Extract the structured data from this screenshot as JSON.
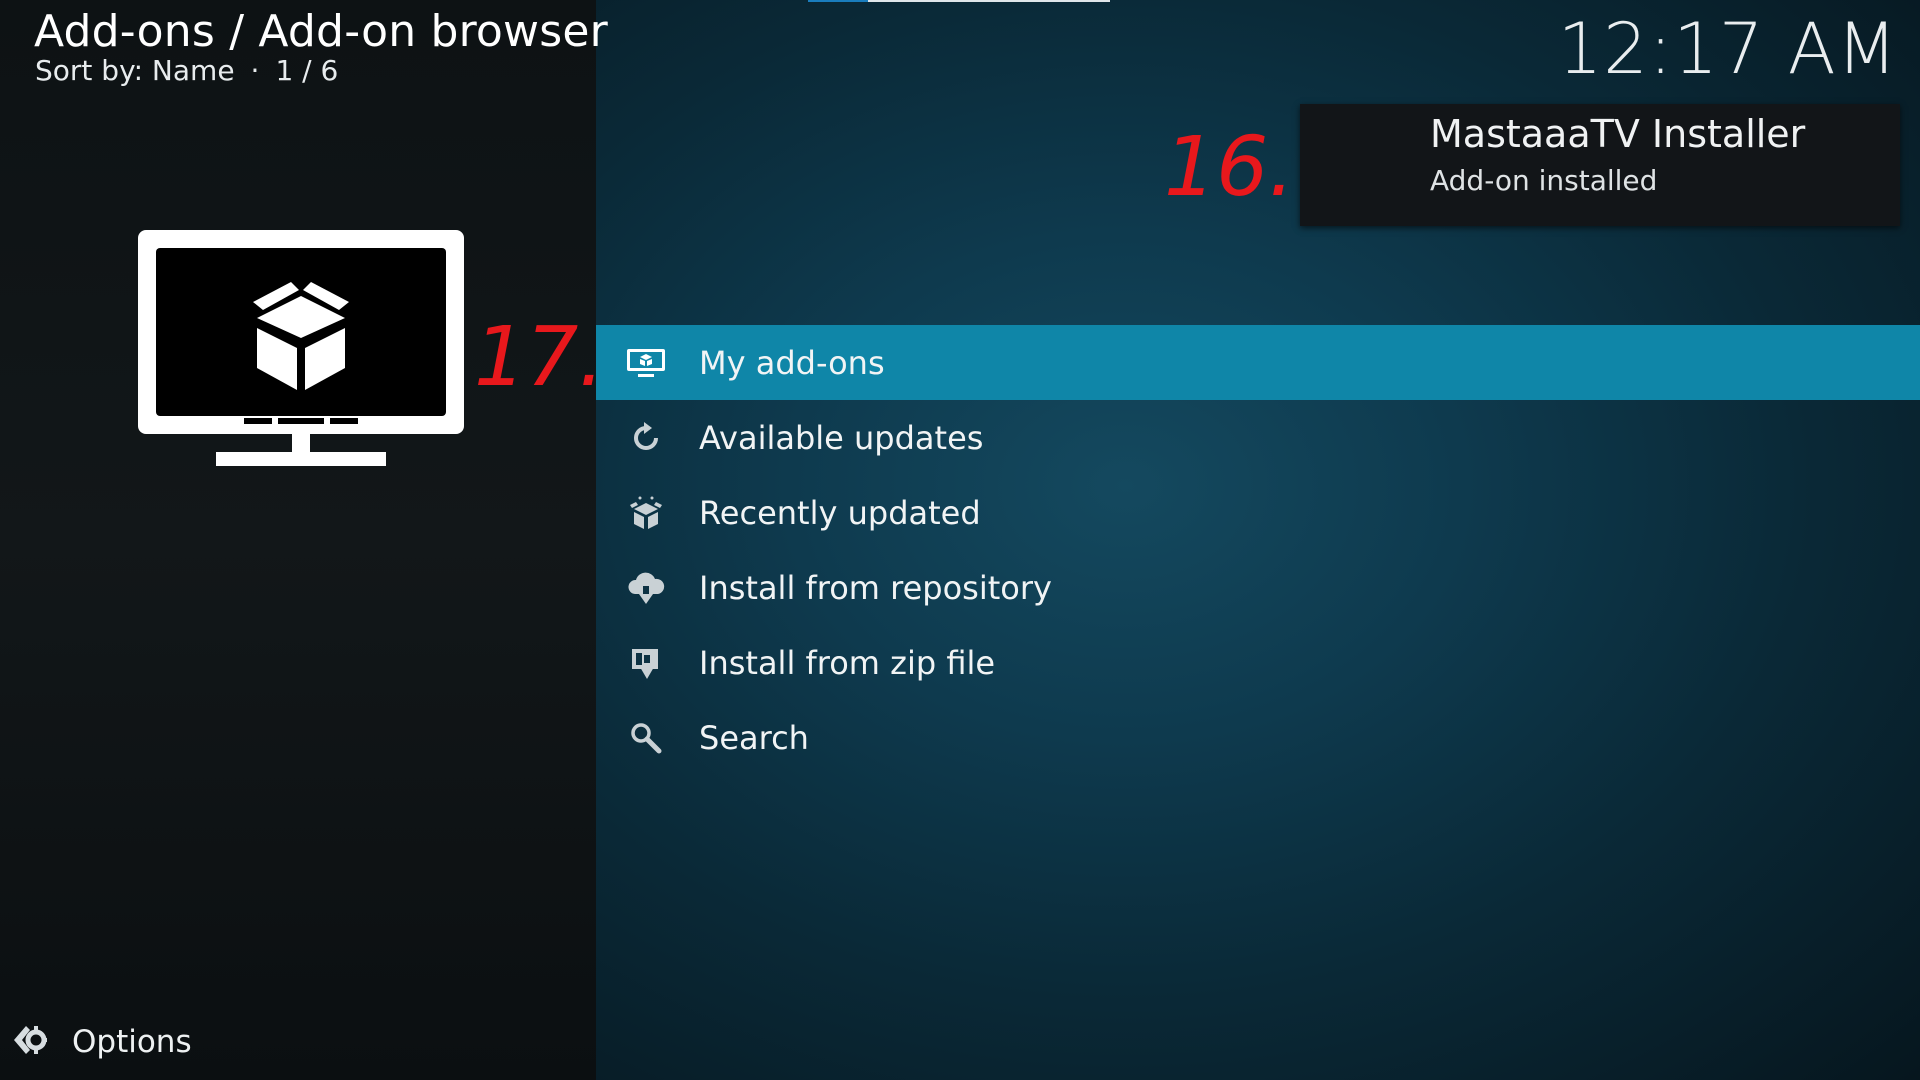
{
  "header": {
    "breadcrumb": "Add-ons / Add-on browser",
    "sort_label": "Sort by: Name",
    "sort_sep": "·",
    "position": "1 / 6",
    "clock": "12:17 AM"
  },
  "notification": {
    "title": "MastaaaTV Installer",
    "message": "Add-on installed"
  },
  "annotations": {
    "step16": "16.",
    "step17": "17."
  },
  "thumbnail": {
    "icon": "tv-addon-box-icon"
  },
  "menu": {
    "items": [
      {
        "label": "My add-ons",
        "icon": "monitor-box-icon",
        "selected": true
      },
      {
        "label": "Available updates",
        "icon": "refresh-icon",
        "selected": false
      },
      {
        "label": "Recently updated",
        "icon": "box-sparkle-icon",
        "selected": false
      },
      {
        "label": "Install from repository",
        "icon": "cloud-download-icon",
        "selected": false
      },
      {
        "label": "Install from zip file",
        "icon": "zip-download-icon",
        "selected": false
      },
      {
        "label": "Search",
        "icon": "search-icon",
        "selected": false
      }
    ]
  },
  "footer": {
    "options_label": "Options"
  },
  "colors": {
    "accent": "#0f86a8",
    "annotation": "#e8181c"
  }
}
